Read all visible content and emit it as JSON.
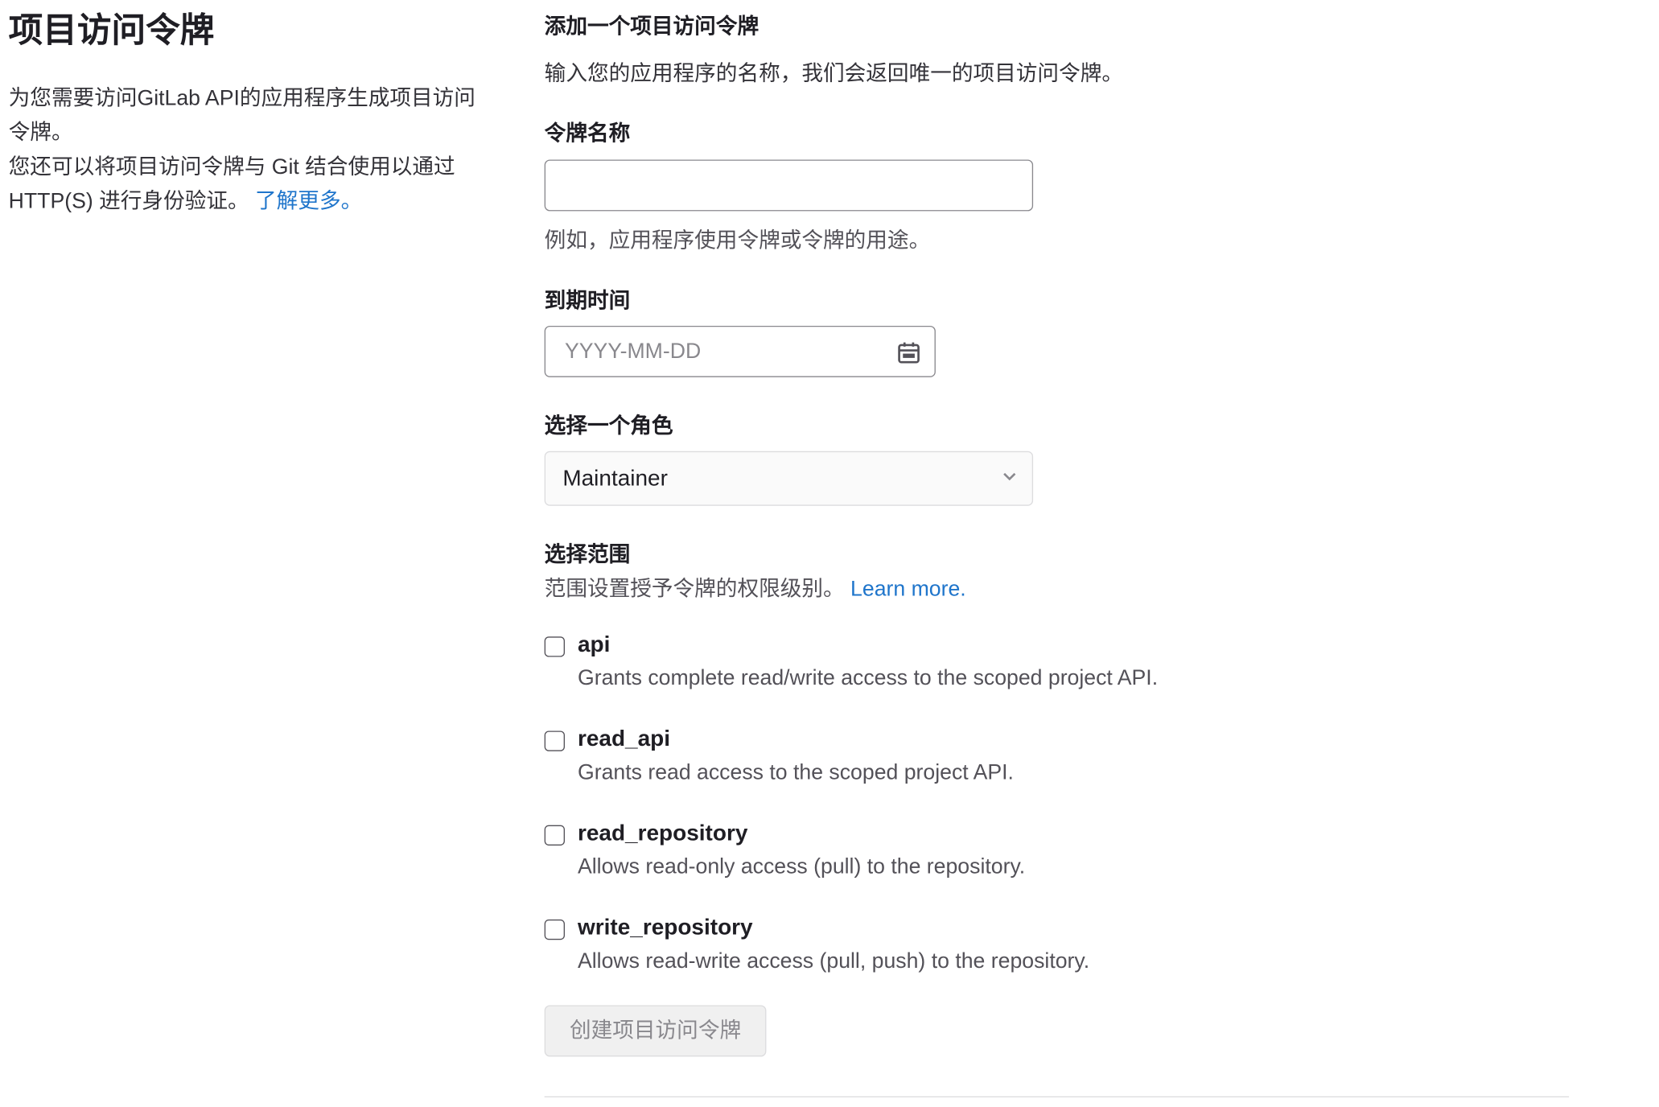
{
  "page": {
    "title": "项目访问令牌",
    "description_line1": "为您需要访问GitLab API的应用程序生成项目访问令牌。",
    "description_line2": "您还可以将项目访问令牌与 Git 结合使用以通过 HTTP(S) 进行身份验证。",
    "learn_more": "了解更多。"
  },
  "form": {
    "section_title": "添加一个项目访问令牌",
    "intro": "输入您的应用程序的名称，我们会返回唯一的项目访问令牌。",
    "token_name": {
      "label": "令牌名称",
      "value": "",
      "help": "例如，应用程序使用令牌或令牌的用途。"
    },
    "expiration": {
      "label": "到期时间",
      "placeholder": "YYYY-MM-DD",
      "icon": "calendar-icon"
    },
    "role": {
      "label": "选择一个角色",
      "selected": "Maintainer",
      "icon": "chevron-down-icon"
    },
    "scopes": {
      "label": "选择范围",
      "help": "范围设置授予令牌的权限级别。",
      "learn_more": "Learn more.",
      "items": [
        {
          "name": "api",
          "description": "Grants complete read/write access to the scoped project API.",
          "checked": false
        },
        {
          "name": "read_api",
          "description": "Grants read access to the scoped project API.",
          "checked": false
        },
        {
          "name": "read_repository",
          "description": "Allows read-only access (pull) to the repository.",
          "checked": false
        },
        {
          "name": "write_repository",
          "description": "Allows read-write access (pull, push) to the repository.",
          "checked": false
        }
      ]
    },
    "submit_label": "创建项目访问令牌"
  },
  "colors": {
    "link": "#1f75cb",
    "text": "#333238",
    "muted": "#535158",
    "border": "#89888d",
    "button_disabled_bg": "#f0f0f0"
  }
}
